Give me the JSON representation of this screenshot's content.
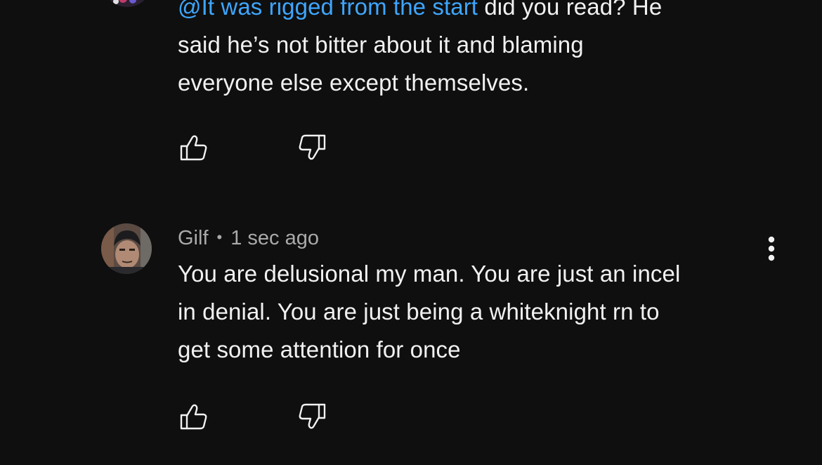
{
  "comments": [
    {
      "mention": "@It was rigged from the start",
      "text_line1_rest": " did you read? He",
      "text_line2": "said he’s not bitter about it and blaming",
      "text_line3": "everyone else except themselves."
    },
    {
      "author": "Gilf",
      "separator": "•",
      "time": "1 sec ago",
      "text_line1": "You are delusional my man. You are just an incel",
      "text_line2": "in denial. You are just being a whiteknight rn to",
      "text_line3": "get some attention for once"
    }
  ],
  "icons": {
    "like": "thumbs-up-icon",
    "dislike": "thumbs-down-icon",
    "more": "more-vertical-icon"
  },
  "colors": {
    "background": "#0f0f0f",
    "text": "#f1f1f1",
    "secondary_text": "#aaaaaa",
    "mention": "#3ea6ff"
  }
}
